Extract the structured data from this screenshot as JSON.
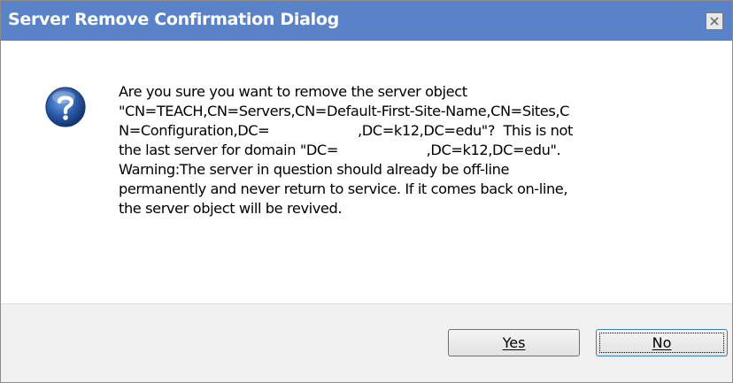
{
  "window": {
    "title": "Server Remove Confirmation Dialog",
    "close_icon": "close-icon"
  },
  "message": {
    "icon": "question-icon",
    "lines": [
      "Are you sure you want to remove the server object",
      "\"CN=TEACH,CN=Servers,CN=Default-First-Site-Name,CN=Sites,C",
      "N=Configuration,DC=                     ,DC=k12,DC=edu\"?  This is not",
      "the last server for domain \"DC=                     ,DC=k12,DC=edu\".",
      "Warning:The server in question should already be off-line",
      "permanently and never return to service. If it comes back on-line,",
      "the server object will be revived."
    ]
  },
  "buttons": {
    "yes_label": "Yes",
    "no_label": "No"
  },
  "colors": {
    "titlebar": "#5a82c8",
    "icon_blue": "#2b5aa8"
  }
}
